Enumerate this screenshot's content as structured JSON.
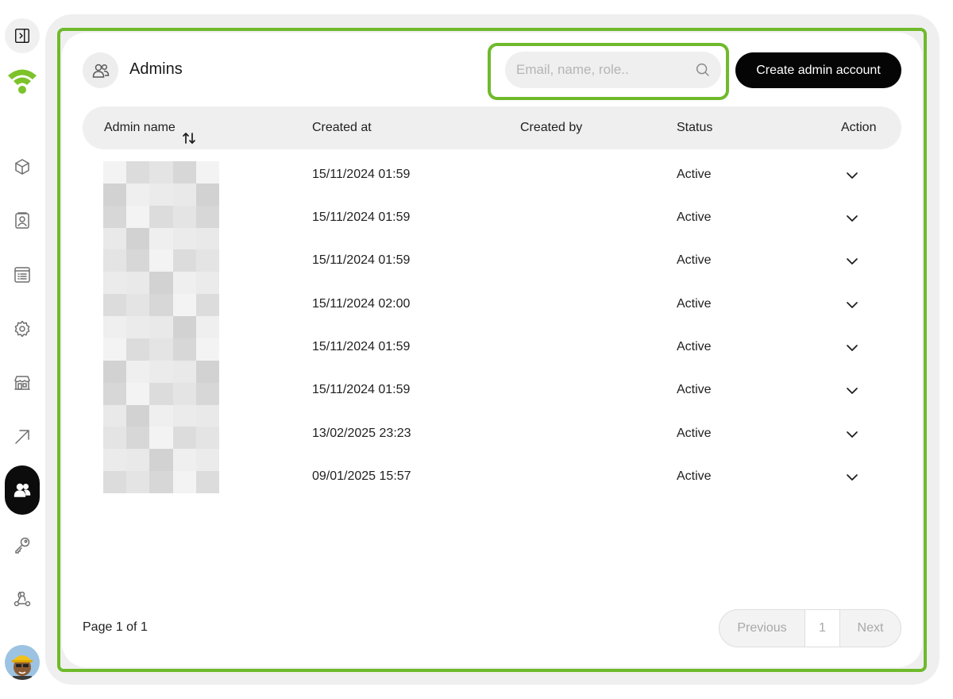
{
  "sidebar": {
    "items": [
      {
        "name": "cube-icon"
      },
      {
        "name": "contact-card-icon"
      },
      {
        "name": "list-icon"
      },
      {
        "name": "gear-icon"
      },
      {
        "name": "store-icon"
      },
      {
        "name": "arrow-up-right-icon"
      },
      {
        "name": "users-icon",
        "active": true
      },
      {
        "name": "key-icon"
      },
      {
        "name": "webhook-icon"
      }
    ],
    "accent": "#7cc22a"
  },
  "header": {
    "title": "Admins",
    "search_placeholder": "Email, name, role..",
    "create_label": "Create admin account"
  },
  "table": {
    "columns": [
      "Admin name",
      "Created at",
      "Created by",
      "Status",
      "Action"
    ],
    "rows": [
      {
        "name": "",
        "created_at": "15/11/2024 01:59",
        "created_by": "",
        "status": "Active"
      },
      {
        "name": "",
        "created_at": "15/11/2024 01:59",
        "created_by": "",
        "status": "Active"
      },
      {
        "name": "",
        "created_at": "15/11/2024 01:59",
        "created_by": "",
        "status": "Active"
      },
      {
        "name": "",
        "created_at": "15/11/2024 02:00",
        "created_by": "",
        "status": "Active"
      },
      {
        "name": "",
        "created_at": "15/11/2024 01:59",
        "created_by": "",
        "status": "Active"
      },
      {
        "name": "",
        "created_at": "15/11/2024 01:59",
        "created_by": "",
        "status": "Active"
      },
      {
        "name": "",
        "created_at": "13/02/2025 23:23",
        "created_by": "",
        "status": "Active"
      },
      {
        "name": "",
        "created_at": "09/01/2025 15:57",
        "created_by": "",
        "status": "Active"
      }
    ]
  },
  "pagination": {
    "info": "Page 1 of 1",
    "previous": "Previous",
    "current": "1",
    "next": "Next"
  },
  "colors": {
    "highlight": "#6fba2c",
    "primary_button": "#050505"
  }
}
